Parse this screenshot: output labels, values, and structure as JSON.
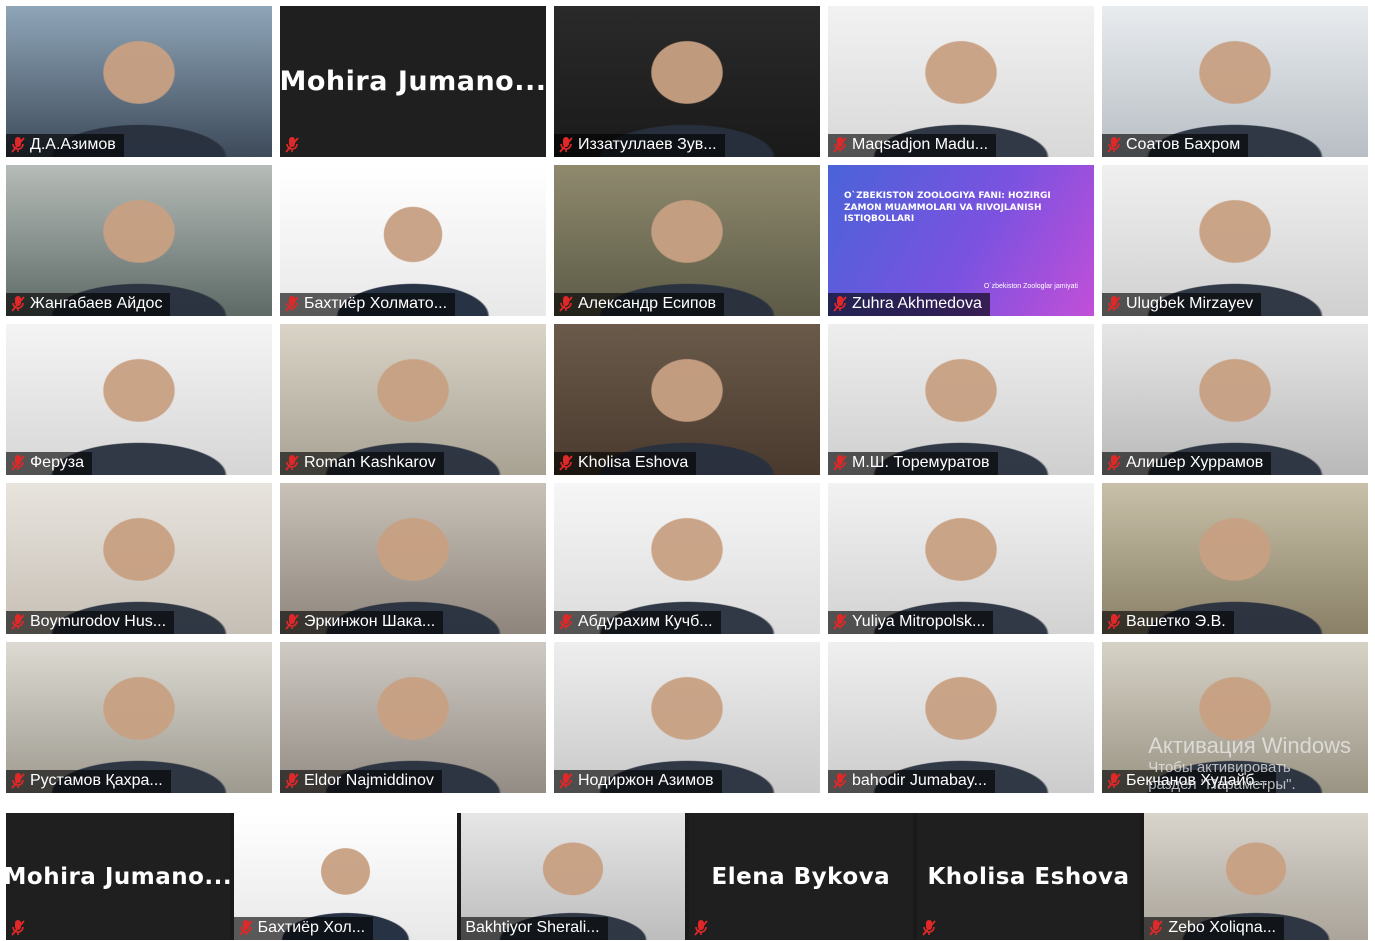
{
  "main_grid": [
    {
      "name": "Д.А.Азимов",
      "kind": "video",
      "active": true,
      "bg1": "#8fa6b8",
      "bg2": "#3d4a5a"
    },
    {
      "name": "",
      "kind": "avatar",
      "avatar_text": "Mohira  Jumano..."
    },
    {
      "name": "Иззатуллаев Зув...",
      "kind": "video",
      "bg1": "#2a2a2a",
      "bg2": "#1a1a1a"
    },
    {
      "name": "Maqsadjon Madu...",
      "kind": "video",
      "bg1": "#f2f2f2",
      "bg2": "#d8d8d8"
    },
    {
      "name": "Соатов Бахром",
      "kind": "video",
      "bg1": "#e8ecef",
      "bg2": "#b8bec4"
    },
    {
      "name": "Жангабаев Айдос",
      "kind": "video",
      "bg1": "#b6bcb8",
      "bg2": "#5d6a66"
    },
    {
      "name": "Бахтиёр Холмато...",
      "kind": "board"
    },
    {
      "name": "Александр Есипов",
      "kind": "video",
      "bg1": "#8f8a6e",
      "bg2": "#5c5a46"
    },
    {
      "name": "Zuhra Akhmedova",
      "kind": "slide"
    },
    {
      "name": "Ulugbek Mirzayev",
      "kind": "video",
      "bg1": "#f0f0f0",
      "bg2": "#d0d0d0"
    },
    {
      "name": "Феруза",
      "kind": "video",
      "bg1": "#f4f4f4",
      "bg2": "#d6d6d6"
    },
    {
      "name": "Roman Kashkarov",
      "kind": "video",
      "bg1": "#d9d4c7",
      "bg2": "#a8a293"
    },
    {
      "name": "Kholisa Eshova",
      "kind": "video",
      "bg1": "#6a5a4a",
      "bg2": "#4a3a2e"
    },
    {
      "name": "М.Ш. Торемуратов",
      "kind": "video",
      "bg1": "#eeeeee",
      "bg2": "#cfcfcf"
    },
    {
      "name": "Алишер Хуррамов",
      "kind": "video",
      "bg1": "#e6e6e6",
      "bg2": "#b9b9b9"
    },
    {
      "name": "Boymurodov Hus...",
      "kind": "video",
      "bg1": "#e8e4de",
      "bg2": "#c6bfb5"
    },
    {
      "name": "Эркинжон Шака...",
      "kind": "video",
      "bg1": "#c9c2b8",
      "bg2": "#8e867c"
    },
    {
      "name": "Абдурахим Кучб...",
      "kind": "video",
      "bg1": "#f6f6f6",
      "bg2": "#dcdcdc"
    },
    {
      "name": "Yuliya Mitropolsk...",
      "kind": "video",
      "bg1": "#f2f2f2",
      "bg2": "#d2d2d2"
    },
    {
      "name": "Вашетко Э.В.",
      "kind": "video",
      "bg1": "#c8c0a8",
      "bg2": "#8a8068"
    },
    {
      "name": "Рустамов Қахра...",
      "kind": "video",
      "bg1": "#dcdad2",
      "bg2": "#9e9a90"
    },
    {
      "name": "Eldor Najmiddinov",
      "kind": "video",
      "bg1": "#cfcac4",
      "bg2": "#938c84"
    },
    {
      "name": "Нодиржон Азимов",
      "kind": "video",
      "bg1": "#eeeeee",
      "bg2": "#c9c9c9"
    },
    {
      "name": "bahodir Jumabay...",
      "kind": "video",
      "bg1": "#efefef",
      "bg2": "#cccccc"
    },
    {
      "name": "Бекчанов Худайб...",
      "kind": "video",
      "bg1": "#d6d2c6",
      "bg2": "#9a9484"
    }
  ],
  "slide": {
    "title": "O`ZBEKISTON ZOOLOGIYA FANI: HOZIRGI ZAMON MUAMMOLARI VA RIVOJLANISH ISTIQBOLLARI",
    "footer": "O`zbekiston Zoologlar jamiyati"
  },
  "strip": [
    {
      "name": "",
      "kind": "avatar",
      "avatar_text": "Mohira  Jumano..."
    },
    {
      "name": "Бахтиёр Хол...",
      "kind": "board"
    },
    {
      "name": "Bakhtiyor Sherali...",
      "kind": "video",
      "active": true,
      "bg1": "#e6e6e6",
      "bg2": "#bdbdbd",
      "label_nomic": true
    },
    {
      "name": "",
      "kind": "avatar",
      "avatar_text": "Elena Bykova"
    },
    {
      "name": "",
      "kind": "avatar",
      "avatar_text": "Kholisa Eshova"
    },
    {
      "name": "Zebo Xoliqna...",
      "kind": "video",
      "bg1": "#d8d4cc",
      "bg2": "#aaa49a"
    }
  ],
  "watermark": {
    "line1": "Активация Windows",
    "line2": "Чтобы активировать",
    "line3": "раздел \"Параметры\"."
  },
  "colors": {
    "active_border": "#b7e33f",
    "muted_mic": "#e02828",
    "tile_bg": "#1f1f1f"
  },
  "icons": {
    "muted_mic": "muted-mic-icon"
  }
}
